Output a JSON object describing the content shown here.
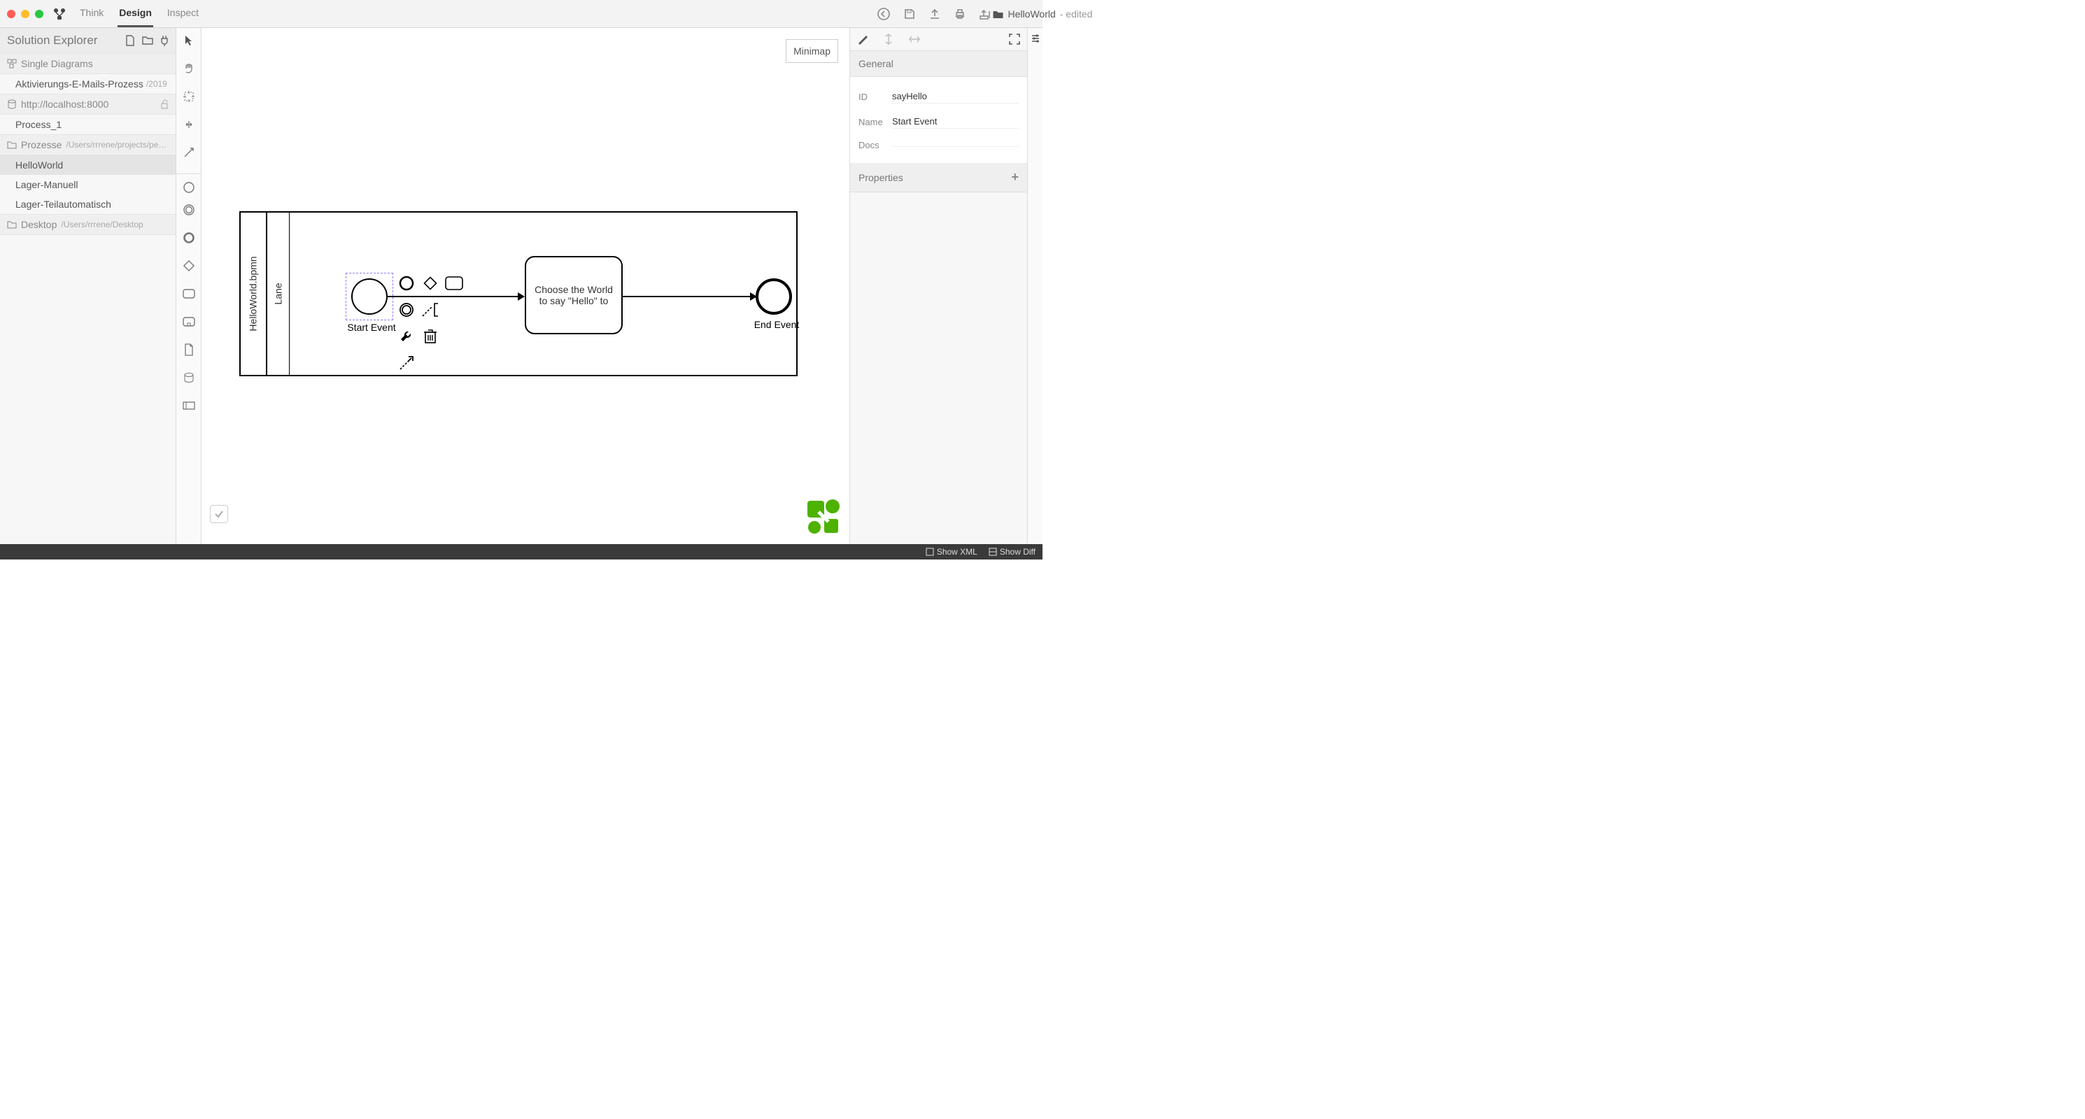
{
  "titlebar": {
    "tabs": [
      "Think",
      "Design",
      "Inspect"
    ],
    "active_tab": "Design",
    "file_name": "HelloWorld",
    "edited_suffix": " - edited"
  },
  "sidebar": {
    "title": "Solution Explorer",
    "sections": {
      "single_diagrams": {
        "label": "Single Diagrams",
        "items": [
          {
            "label": "Aktivierungs-E-Mails-Prozess",
            "meta": "/2019"
          }
        ]
      },
      "localhost": {
        "label": "http://localhost:8000",
        "items": [
          {
            "label": "Process_1"
          }
        ]
      },
      "prozesse": {
        "label": "Prozesse",
        "path": "/Users/rrrene/projects/pe…",
        "items": [
          {
            "label": "HelloWorld",
            "selected": true
          },
          {
            "label": "Lager-Manuell"
          },
          {
            "label": "Lager-Teilautomatisch"
          }
        ]
      },
      "desktop": {
        "label": "Desktop",
        "path": "/Users/rrrene/Desktop"
      }
    }
  },
  "canvas": {
    "minimap": "Minimap",
    "pool_title": "HelloWorld.bpmn",
    "lane_title": "Lane",
    "start_label": "Start Event",
    "end_label": "End Event",
    "task_label": "Choose the World to say \"Hello\" to"
  },
  "props": {
    "general_label": "General",
    "properties_label": "Properties",
    "rows": {
      "id_lab": "ID",
      "id_val": "sayHello",
      "name_lab": "Name",
      "name_val": "Start Event",
      "docs_lab": "Docs",
      "docs_val": ""
    }
  },
  "status": {
    "xml": "Show XML",
    "diff": "Show Diff"
  }
}
